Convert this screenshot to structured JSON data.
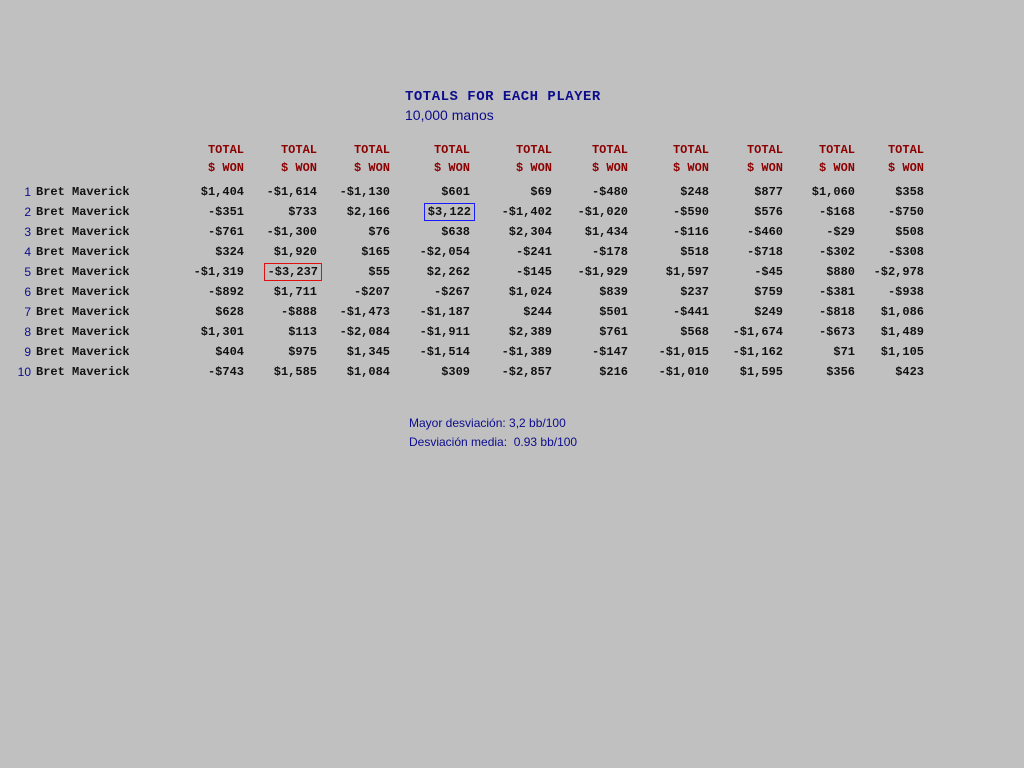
{
  "title": "TOTALS FOR EACH PLAYER",
  "subtitle": "10,000 manos",
  "column_header": {
    "line1": "TOTAL",
    "line2": "$ WON"
  },
  "columns": 10,
  "rows": [
    {
      "num": "1",
      "name": "Bret Maverick",
      "values": [
        "$1,404",
        "-$1,614",
        "-$1,130",
        "$601",
        "$69",
        "-$480",
        "$248",
        "$877",
        "$1,060",
        "$358"
      ]
    },
    {
      "num": "2",
      "name": "Bret Maverick",
      "values": [
        "-$351",
        "$733",
        "$2,166",
        "$3,122",
        "-$1,402",
        "-$1,020",
        "-$590",
        "$576",
        "-$168",
        "-$750"
      ]
    },
    {
      "num": "3",
      "name": "Bret Maverick",
      "values": [
        "-$761",
        "-$1,300",
        "$76",
        "$638",
        "$2,304",
        "$1,434",
        "-$116",
        "-$460",
        "-$29",
        "$508"
      ]
    },
    {
      "num": "4",
      "name": "Bret Maverick",
      "values": [
        "$324",
        "$1,920",
        "$165",
        "-$2,054",
        "-$241",
        "-$178",
        "$518",
        "-$718",
        "-$302",
        "-$308"
      ]
    },
    {
      "num": "5",
      "name": "Bret Maverick",
      "values": [
        "-$1,319",
        "-$3,237",
        "$55",
        "$2,262",
        "-$145",
        "-$1,929",
        "$1,597",
        "-$45",
        "$880",
        "-$2,978"
      ]
    },
    {
      "num": "6",
      "name": "Bret Maverick",
      "values": [
        "-$892",
        "$1,711",
        "-$207",
        "-$267",
        "$1,024",
        "$839",
        "$237",
        "$759",
        "-$381",
        "-$938"
      ]
    },
    {
      "num": "7",
      "name": "Bret Maverick",
      "values": [
        "$628",
        "-$888",
        "-$1,473",
        "-$1,187",
        "$244",
        "$501",
        "-$441",
        "$249",
        "-$818",
        "$1,086"
      ]
    },
    {
      "num": "8",
      "name": "Bret Maverick",
      "values": [
        "$1,301",
        "$113",
        "-$2,084",
        "-$1,911",
        "$2,389",
        "$761",
        "$568",
        "-$1,674",
        "-$673",
        "$1,489"
      ]
    },
    {
      "num": "9",
      "name": "Bret Maverick",
      "values": [
        "$404",
        "$975",
        "$1,345",
        "-$1,514",
        "-$1,389",
        "-$147",
        "-$1,015",
        "-$1,162",
        "$71",
        "$1,105"
      ]
    },
    {
      "num": "10",
      "name": "Bret Maverick",
      "values": [
        "-$743",
        "$1,585",
        "$1,084",
        "$309",
        "-$2,857",
        "$216",
        "-$1,010",
        "$1,595",
        "$356",
        "$423"
      ]
    }
  ],
  "highlights": [
    {
      "row": 1,
      "col": 3,
      "color": "#1a1aff"
    },
    {
      "row": 4,
      "col": 1,
      "color": "#e01010"
    }
  ],
  "stats": {
    "max_dev": "Mayor desviación: 3,2 bb/100",
    "avg_dev": "Desviación media:  0.93 bb/100"
  }
}
